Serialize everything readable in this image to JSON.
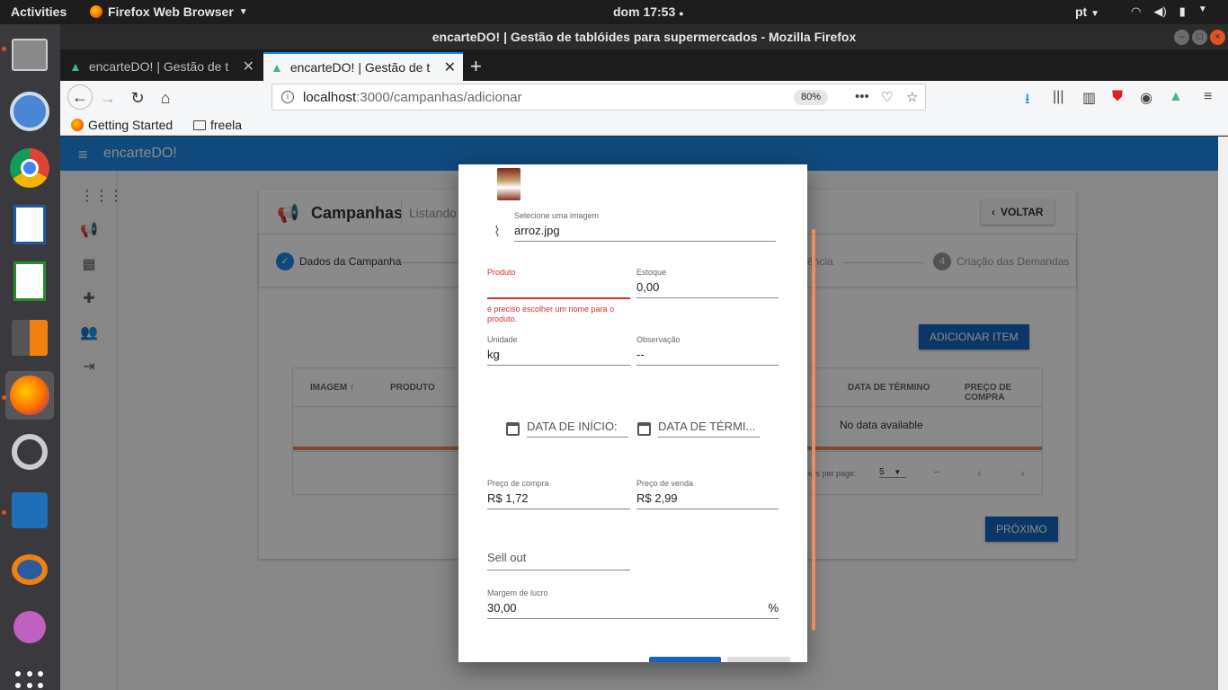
{
  "topbar": {
    "activities": "Activities",
    "app_name": "Firefox Web Browser",
    "clock": "dom 17:53",
    "lang": "pt"
  },
  "window": {
    "title": "encarteDO! | Gestão de tablóides para supermercados - Mozilla Firefox"
  },
  "tabs": [
    {
      "label": "encarteDO! | Gestão de t"
    },
    {
      "label": "encarteDO! | Gestão de t"
    }
  ],
  "url": {
    "host": "localhost",
    "path": ":3000/campanhas/adicionar",
    "zoom": "80%"
  },
  "bookmarks": [
    {
      "label": "Getting Started"
    },
    {
      "label": "freela"
    }
  ],
  "app": {
    "brand": "encarteDO!",
    "page_title": "Campanhas",
    "page_subtitle": "Listando c",
    "back_label": "VOLTAR",
    "steps": [
      {
        "number": "✓",
        "label": "Dados da Campanha"
      },
      {
        "number": "",
        "label": "rência"
      },
      {
        "number": "4",
        "label": "Criação das Demandas"
      }
    ],
    "add_item_label": "ADICIONAR ITEM",
    "table": {
      "headers": [
        "IMAGEM",
        "PRODUTO",
        "DATA DE TÉRMINO",
        "PREÇO DE COMPRA"
      ],
      "empty": "No data available",
      "rows_per_page_label": "ows per page:",
      "rows_per_page": "5",
      "range": "–"
    },
    "next_label": "PRÓXIMO"
  },
  "modal": {
    "image_label": "Selecione uma imagem",
    "image_value": "arroz.jpg",
    "produto": {
      "label": "Produto",
      "value": "",
      "error": "é preciso escolher um nome para o produto."
    },
    "estoque": {
      "label": "Estoque",
      "value": "0,00"
    },
    "unidade": {
      "label": "Unidade",
      "value": "kg"
    },
    "observacao": {
      "label": "Observação",
      "value": "--"
    },
    "data_inicio": "DATA DE INÍCIO:",
    "data_termino": "DATA DE TÉRMI...",
    "preco_compra": {
      "label": "Preço de compra",
      "value": "R$ 1,72"
    },
    "preco_venda": {
      "label": "Preço de venda",
      "value": "R$ 2,99"
    },
    "sell_out": {
      "label": "Sell out",
      "value": ""
    },
    "margem": {
      "label": "Margem de lucro",
      "value": "30,00",
      "suffix": "%"
    }
  }
}
